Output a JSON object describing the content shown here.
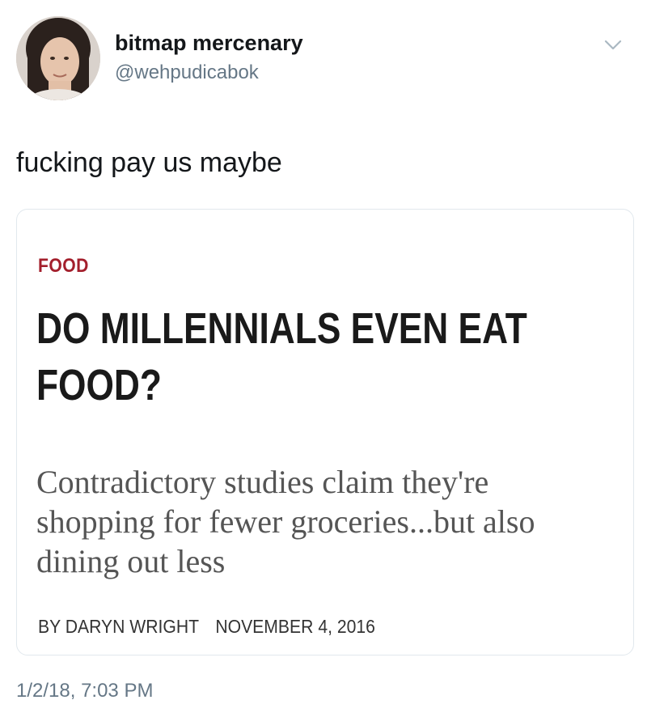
{
  "tweet": {
    "display_name": "bitmap mercenary",
    "handle": "@wehpudicabok",
    "text": "fucking pay us maybe",
    "timestamp": "1/2/18, 7:03 PM"
  },
  "card": {
    "category": "FOOD",
    "headline": "DO MILLENNIALS EVEN EAT FOOD?",
    "dek": "Contradictory studies claim they're shopping for fewer groceries...but also dining out less",
    "byline": "BY DARYN WRIGHT",
    "date": "NOVEMBER 4, 2016"
  },
  "colors": {
    "category_accent": "#a31f2c",
    "secondary_text": "#657786",
    "card_border": "#e1e8ed"
  },
  "icons": {
    "menu": "chevron-down-icon"
  }
}
